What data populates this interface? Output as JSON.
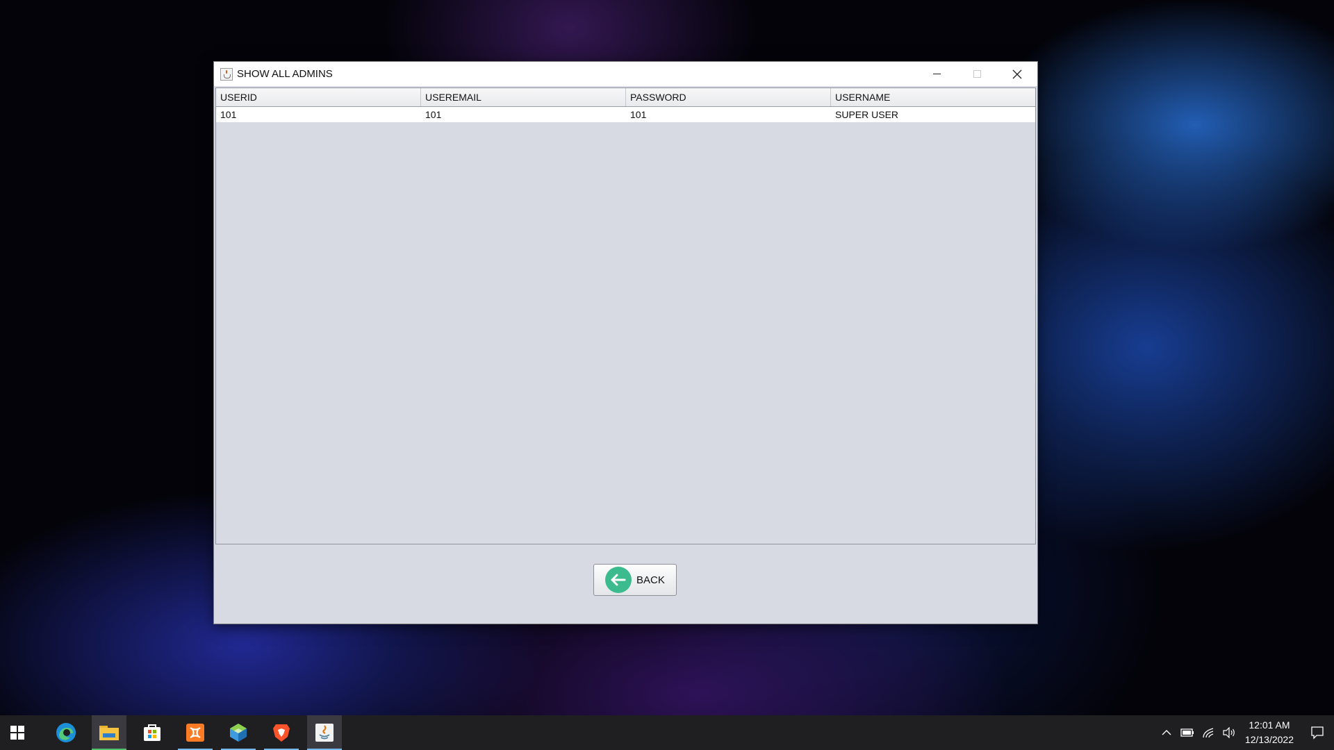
{
  "window": {
    "title": "SHOW ALL ADMINS",
    "controls": {
      "minimize": "minimize",
      "maximize": "maximize",
      "close": "close"
    }
  },
  "table": {
    "columns": [
      "USERID",
      "USEREMAIL",
      "PASSWORD",
      "USERNAME"
    ],
    "rows": [
      [
        "101",
        "101",
        "101",
        "SUPER USER"
      ]
    ]
  },
  "back_button": {
    "label": "BACK",
    "icon": "arrow-left-icon"
  },
  "taskbar": {
    "apps": [
      "windows-start",
      "edge",
      "file-explorer",
      "microsoft-store",
      "xampp",
      "netbeans",
      "brave",
      "java"
    ],
    "clock": {
      "time": "12:01 AM",
      "date": "12/13/2022"
    }
  },
  "colors": {
    "window_bg": "#d7dae2",
    "back_icon": "#3cbb8f",
    "taskbar": "#1f1f22"
  }
}
